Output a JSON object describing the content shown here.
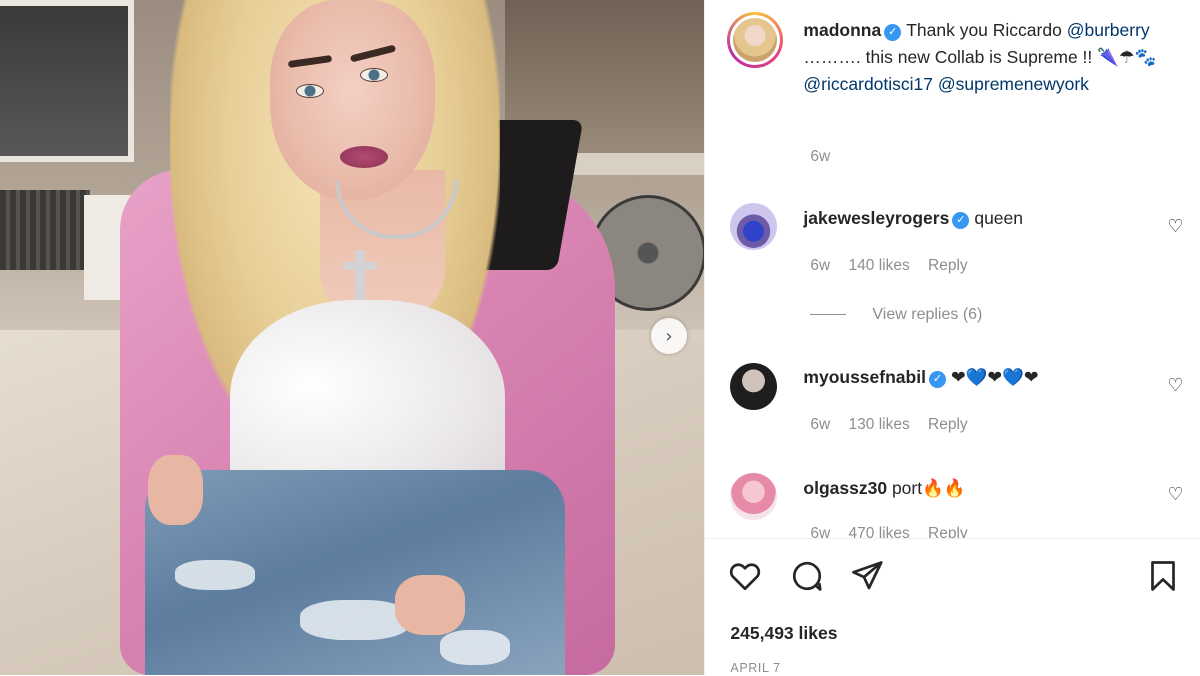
{
  "post": {
    "author": "madonna",
    "caption_text": "Thank you Riccardo",
    "caption_mention1": "@burberry",
    "caption_mid": " ………. this new Collab is Supreme !! 🌂☂🐾",
    "caption_mention2": "@riccardotisci17",
    "caption_mention3": "@supremenewyork",
    "caption_age": "6w"
  },
  "comments": [
    {
      "user": "jakewesleyrogers",
      "verified": true,
      "text": "queen",
      "age": "6w",
      "likes": "140 likes",
      "reply": "Reply",
      "view_replies": "View replies (6)"
    },
    {
      "user": "myoussefnabil",
      "verified": true,
      "text": "❤💙❤💙❤",
      "age": "6w",
      "likes": "130 likes",
      "reply": "Reply"
    },
    {
      "user": "olgassz30",
      "verified": false,
      "text": "port🔥🔥",
      "age": "6w",
      "likes": "470 likes",
      "reply": "Reply"
    }
  ],
  "footer": {
    "likes": "245,493 likes",
    "date": "APRIL 7"
  },
  "icons": {
    "verified": "verified-badge-icon",
    "like": "heart-icon",
    "comment": "comment-bubble-icon",
    "share": "paper-plane-icon",
    "save": "bookmark-icon",
    "next": "chevron-right-icon"
  },
  "colors": {
    "verified": "#3897f0",
    "mention": "#00376b",
    "muted": "#8e8e8e",
    "text": "#262626"
  }
}
